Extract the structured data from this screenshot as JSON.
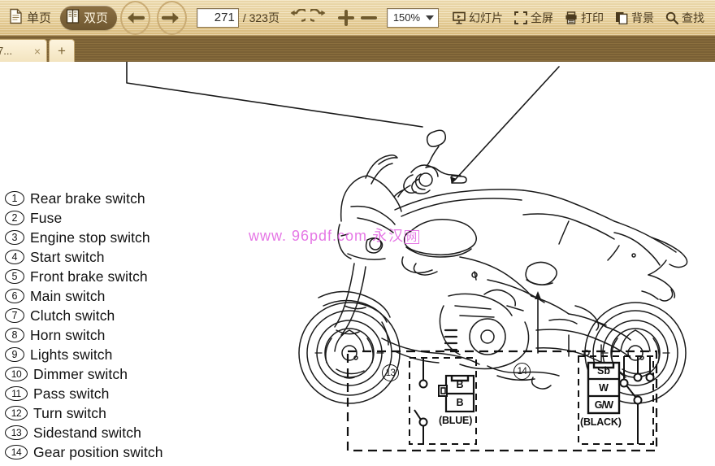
{
  "toolbar": {
    "single_page_label": "单页",
    "double_page_label": "双页",
    "prev_label": "上一页",
    "next_label": "下一页",
    "page_number": "271",
    "page_total": "/ 323页",
    "rotate_left_label": "向左旋转",
    "rotate_right_label": "向右旋转",
    "zoom_in_label": "放大",
    "zoom_out_label": "缩小",
    "zoom_level": "150%",
    "slideshow_label": "幻灯片",
    "fullscreen_label": "全屏",
    "print_label": "打印",
    "background_label": "背景",
    "find_label": "查找"
  },
  "tabs": {
    "doc_tab_label": "7...",
    "close_label": "×",
    "new_tab_label": "+"
  },
  "watermark": {
    "url": "www. 96pdf.com",
    "cn": "永汉",
    "box": "网"
  },
  "switch_list": [
    {
      "num": "1",
      "label": "Rear brake switch"
    },
    {
      "num": "2",
      "label": "Fuse"
    },
    {
      "num": "3",
      "label": "Engine stop switch"
    },
    {
      "num": "4",
      "label": "Start switch"
    },
    {
      "num": "5",
      "label": "Front brake switch"
    },
    {
      "num": "6",
      "label": "Main switch"
    },
    {
      "num": "7",
      "label": "Clutch switch"
    },
    {
      "num": "8",
      "label": "Horn switch"
    },
    {
      "num": "9",
      "label": "Lights switch"
    },
    {
      "num": "10",
      "label": "Dimmer switch"
    },
    {
      "num": "11",
      "label": "Pass switch"
    },
    {
      "num": "12",
      "label": "Turn switch"
    },
    {
      "num": "13",
      "label": "Sidestand switch"
    },
    {
      "num": "14",
      "label": "Gear position switch"
    }
  ],
  "connector_diagram": {
    "left": {
      "callout": "13",
      "terminals": [
        "B",
        "B"
      ],
      "color_label": "(BLUE)"
    },
    "right": {
      "callout": "14",
      "terminals": [
        "Sb",
        "W",
        "G/W"
      ],
      "color_label": "(BLACK)"
    }
  },
  "colors": {
    "toolbar_bg": "#ecd8a6",
    "tabbar_bg": "#7a6035",
    "active_pill": "#7a5f33",
    "watermark": "#e05ae0",
    "page_bg": "#ffffff",
    "ink": "#111111"
  }
}
